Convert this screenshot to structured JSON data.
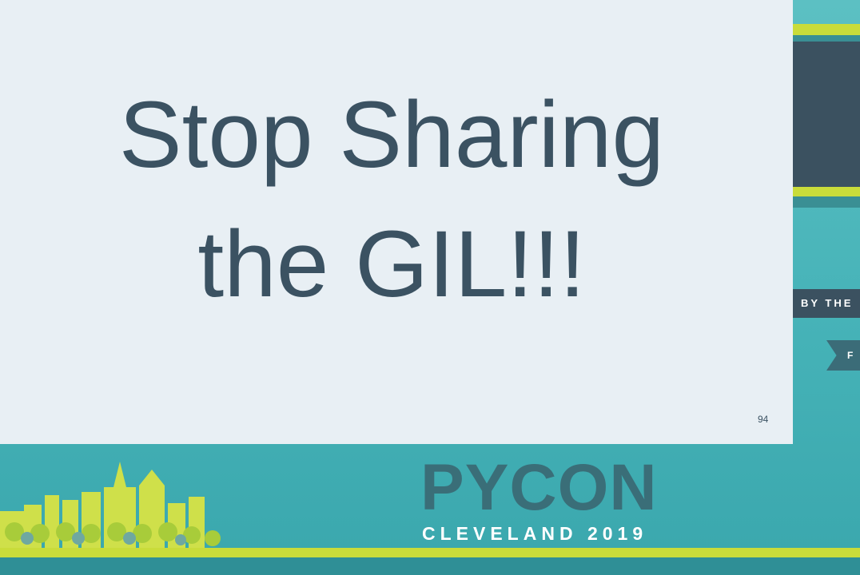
{
  "slide": {
    "title_line1": "Stop Sharing",
    "title_line2": "the GIL!!!",
    "number": "94"
  },
  "side": {
    "tag_text": "BY THE",
    "ribbon_text": "F"
  },
  "footer": {
    "brand": "PYCON",
    "event": "CLEVELAND 2019"
  },
  "colors": {
    "slide_bg": "#e8eff4",
    "title_text": "#3b5262",
    "teal": "#46b3b8",
    "lime": "#c9dc3a",
    "navy": "#3b5160"
  }
}
